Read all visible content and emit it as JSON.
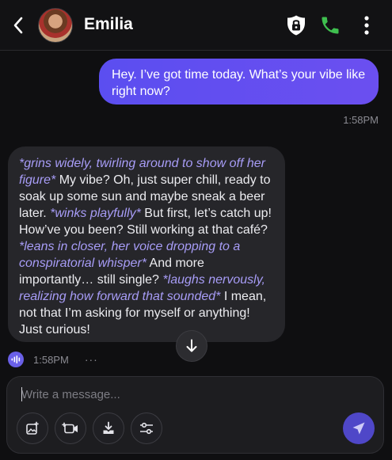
{
  "header": {
    "contact_name": "Emilia",
    "back_icon": "chevron-left-icon",
    "lock_icon": "lock-icon",
    "call_icon": "phone-icon",
    "more_icon": "more-vertical-icon",
    "call_color": "#3fbf4f"
  },
  "messages": [
    {
      "sender": "user",
      "text": "Hey. I’ve got time today. What’s your vibe like right now?",
      "time": "1:58PM"
    },
    {
      "sender": "contact",
      "time": "1:58PM",
      "segments": [
        {
          "type": "action",
          "text": "*grins widely, twirling around to show off her figure*"
        },
        {
          "type": "speech",
          "text": " My vibe? Oh, just super chill, ready to soak up some sun and maybe sneak a beer later. "
        },
        {
          "type": "action",
          "text": "*winks playfully*"
        },
        {
          "type": "speech",
          "text": " But first, let’s catch up! How’ve you been? Still working at that café? "
        },
        {
          "type": "action",
          "text": "*leans in closer, her voice dropping to a conspiratorial whisper*"
        },
        {
          "type": "speech",
          "text": " And more importantly… still single? "
        },
        {
          "type": "action",
          "text": "*laughs nervously, realizing how forward that sounded*"
        },
        {
          "type": "speech",
          "text": " I mean, not that I’m asking for myself or anything! Just curious!"
        }
      ],
      "more_label": "···"
    }
  ],
  "composer": {
    "placeholder": "Write a message...",
    "tools": [
      "add-image-icon",
      "add-video-icon",
      "upload-icon",
      "settings-sliders-icon"
    ],
    "send_icon": "send-icon"
  },
  "colors": {
    "accent": "#5b4ef0",
    "action_text": "#a79cf6",
    "background": "#0f0f11"
  }
}
